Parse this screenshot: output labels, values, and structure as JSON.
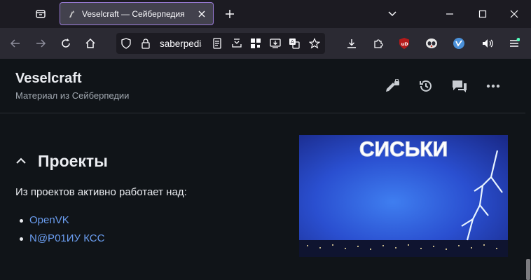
{
  "browser": {
    "tab": {
      "title": "Veselcraft — Сейберпедия"
    },
    "url": "saberpedia",
    "colors": {
      "tab_accent": "#9a7bd8",
      "link": "#6b9ef1",
      "ublock": "#b51a1a"
    }
  },
  "page": {
    "site_title": "Veselcraft",
    "site_subtitle": "Материал из Сейберпедии",
    "section_title": "Проекты",
    "paragraph": "Из проектов активно работает над:",
    "projects": [
      "OpenVK",
      "N@P01ИУ КСС"
    ],
    "image_caption_text": "СИСЬКИ",
    "header_icons": [
      "edit-lock-icon",
      "history-icon",
      "talk-icon",
      "more-icon"
    ]
  }
}
